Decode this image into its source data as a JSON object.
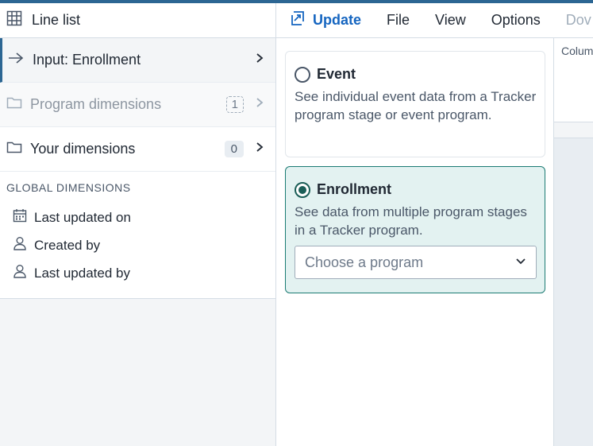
{
  "app": {
    "visualization_type": "Line list",
    "visualization_type_icon": "table-icon"
  },
  "menubar": {
    "update_label": "Update",
    "update_icon": "update-icon",
    "file_label": "File",
    "view_label": "View",
    "options_label": "Options",
    "download_label_partial": "Dov"
  },
  "dimensions": {
    "input": {
      "label": "Input: Enrollment"
    },
    "program": {
      "label": "Program dimensions",
      "count": "1"
    },
    "yours": {
      "label": "Your dimensions",
      "count": "0"
    }
  },
  "global_dimensions": {
    "header": "GLOBAL DIMENSIONS",
    "items": [
      {
        "label": "Last updated on",
        "icon": "calendar-icon"
      },
      {
        "label": "Created by",
        "icon": "user-icon"
      },
      {
        "label": "Last updated by",
        "icon": "user-icon"
      }
    ]
  },
  "input_panel": {
    "event": {
      "title": "Event",
      "description": "See individual event data from a Tracker program stage or event program.",
      "selected": false
    },
    "enrollment": {
      "title": "Enrollment",
      "description": "See data from multiple program stages in a Tracker program.",
      "selected": true,
      "program_placeholder": "Choose a program"
    }
  },
  "layout": {
    "columns_label_partial": "Colum"
  },
  "colors": {
    "accent": "#2c6693",
    "update_blue": "#1565c0",
    "teal_selected": "#1b5e57",
    "teal_bg": "#e3f2f1"
  }
}
